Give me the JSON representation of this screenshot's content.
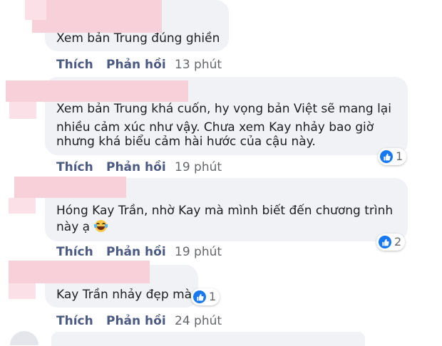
{
  "actions": {
    "like_label": "Thích",
    "reply_label": "Phản hồi"
  },
  "comments": [
    {
      "lines": [
        "Xem bản Trung đúng ghiền"
      ],
      "time": "13 phút",
      "reactions": null
    },
    {
      "lines": [
        "Xem bản Trung khá cuốn, hy vọng bản Việt sẽ mang lại",
        "nhiều cảm xúc như vậy. Chưa xem Kay nhảy bao giờ",
        "nhưng khá biểu cảm hài hước của cậu này."
      ],
      "time": "19 phút",
      "reactions": {
        "icon": "like-icon",
        "count": "1"
      }
    },
    {
      "lines": [
        "Hóng Kay Trần, nhờ Kay mà mình biết đến chương trình",
        "này ạ"
      ],
      "emoji": "laughing-tears-emoji",
      "time": "19 phút",
      "reactions": {
        "icon": "like-icon",
        "count": "2"
      }
    },
    {
      "lines": [
        "Kay Trần nhảy đẹp mà"
      ],
      "time": "24 phút",
      "reactions": {
        "icon": "like-icon",
        "count": "1"
      }
    }
  ],
  "colors": {
    "bubble": "#f0f2f5",
    "action": "#4b5a82",
    "time": "#65676b",
    "like_blue": "#1877f2",
    "redaction_pink": "#f8d0da"
  }
}
